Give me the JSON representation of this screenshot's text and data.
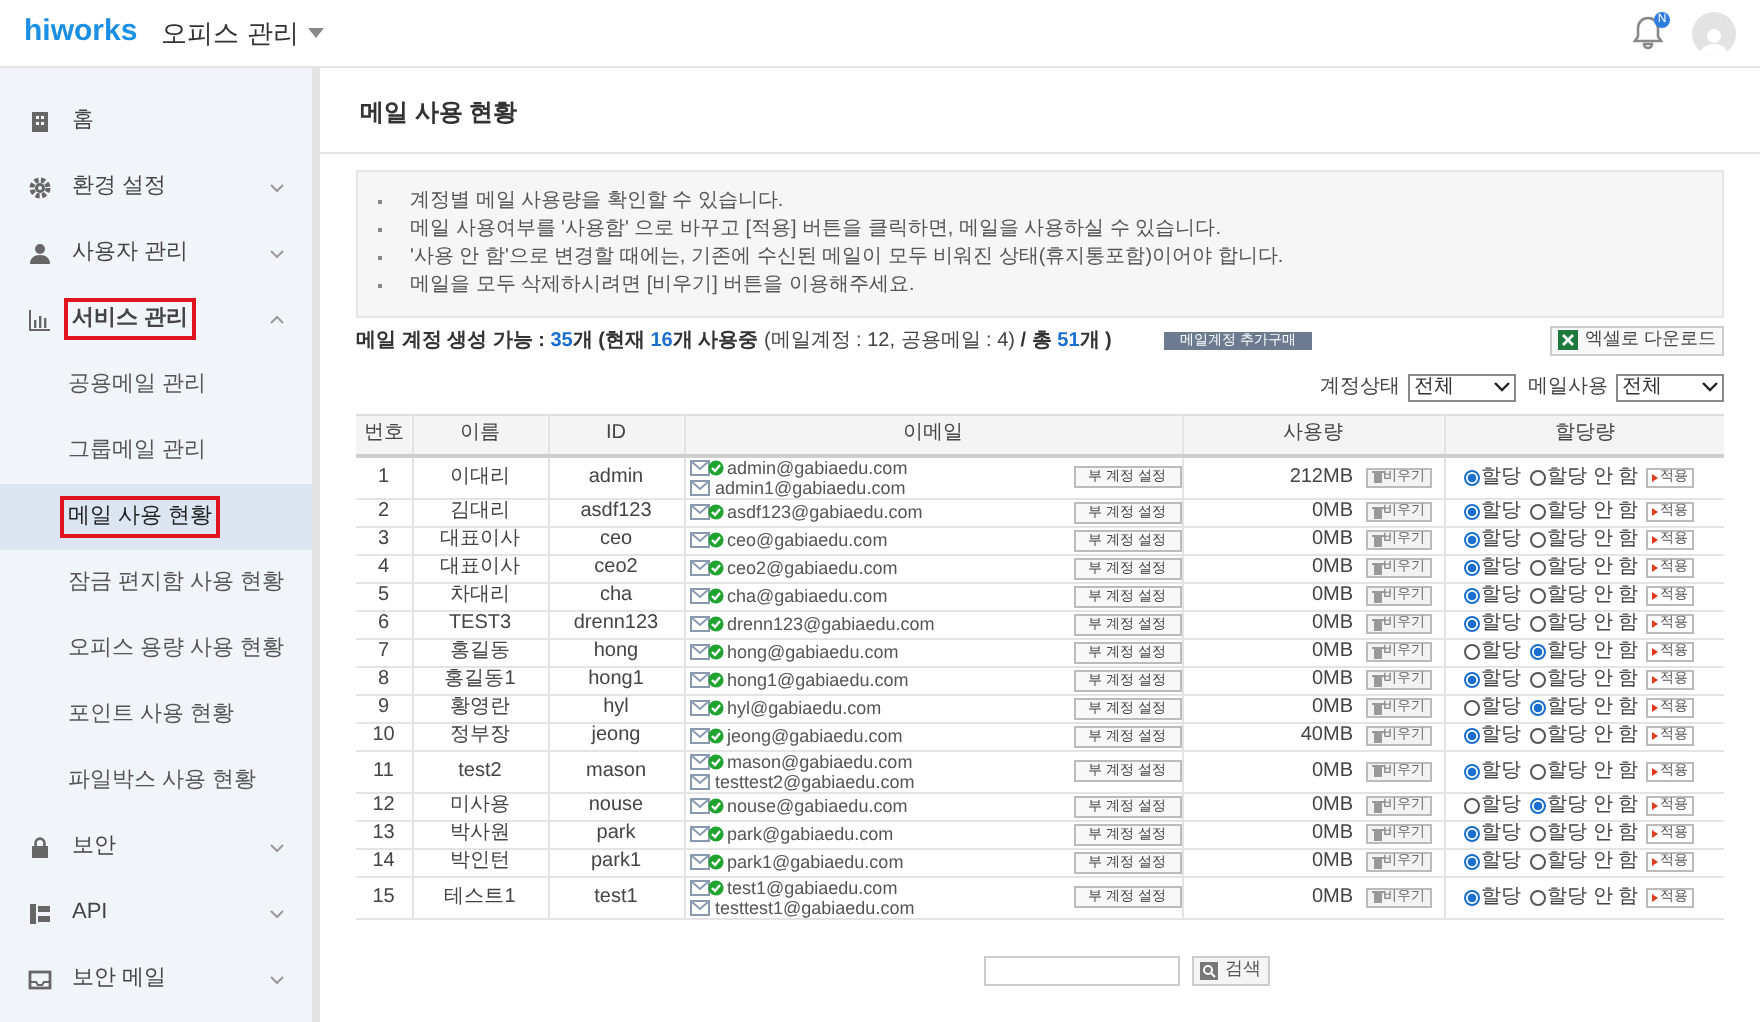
{
  "header": {
    "logo": "hiworks",
    "app_menu": "오피스 관리",
    "notification_badge": "N"
  },
  "sidebar": {
    "items": [
      {
        "label": "홈",
        "kind": "link",
        "highlighted": false
      },
      {
        "label": "환경 설정",
        "kind": "group",
        "expanded": false,
        "highlighted": false
      },
      {
        "label": "사용자 관리",
        "kind": "group",
        "expanded": false,
        "highlighted": false
      },
      {
        "label": "서비스 관리",
        "kind": "group",
        "expanded": true,
        "highlighted": true,
        "children": [
          {
            "label": "공용메일 관리",
            "selected": false,
            "highlighted": false
          },
          {
            "label": "그룹메일 관리",
            "selected": false,
            "highlighted": false
          },
          {
            "label": "메일 사용 현황",
            "selected": true,
            "highlighted": true
          },
          {
            "label": "잠금 편지함 사용 현황",
            "selected": false,
            "highlighted": false
          },
          {
            "label": "오피스 용량 사용 현황",
            "selected": false,
            "highlighted": false
          },
          {
            "label": "포인트 사용 현황",
            "selected": false,
            "highlighted": false
          },
          {
            "label": "파일박스 사용 현황",
            "selected": false,
            "highlighted": false
          }
        ]
      },
      {
        "label": "보안",
        "kind": "group",
        "expanded": false,
        "highlighted": false
      },
      {
        "label": "API",
        "kind": "group",
        "expanded": false,
        "highlighted": false
      },
      {
        "label": "보안 메일",
        "kind": "group",
        "expanded": false,
        "highlighted": false
      }
    ]
  },
  "page_title": "메일 사용 현황",
  "notes": [
    "계정별 메일 사용량을 확인할 수 있습니다.",
    "메일 사용여부를 '사용함' 으로 바꾸고 [적용] 버튼을 클릭하면, 메일을 사용하실 수 있습니다.",
    "'사용 안 함'으로 변경할 때에는, 기존에 수신된 메일이 모두 비워진 상태(휴지통포함)이어야 합니다.",
    "메일을 모두 삭제하시려면 [비우기] 버튼을 이용해주세요."
  ],
  "summary": [
    {
      "text": "메일 계정 생성 가능 : ",
      "kind": "bold"
    },
    {
      "text": "35",
      "kind": "number"
    },
    {
      "text": "개 (현재 ",
      "kind": "bold"
    },
    {
      "text": "16",
      "kind": "number"
    },
    {
      "text": "개 사용중 ",
      "kind": "bold"
    },
    {
      "text": "(메일계정 : 12, 공용메일 : 4)",
      "kind": "plain"
    },
    {
      "text": " / 총 ",
      "kind": "bold"
    },
    {
      "text": "51",
      "kind": "number"
    },
    {
      "text": "개 )",
      "kind": "bold"
    }
  ],
  "buy_button": "메일계정 추가구매",
  "excel_button": "엑셀로 다운로드",
  "filters": [
    {
      "label": "계정상태",
      "value": "전체"
    },
    {
      "label": "메일사용",
      "value": "전체"
    }
  ],
  "table": {
    "columns": [
      "번호",
      "이름",
      "ID",
      "이메일",
      "사용량",
      "할당량"
    ],
    "rows": [
      {
        "no": "1",
        "name": "이대리",
        "id": "admin",
        "emails": [
          {
            "address": "admin@gabiaedu.com",
            "verified": true
          },
          {
            "address": "admin1@gabiaedu.com",
            "verified": false
          }
        ],
        "sub_account_button": "부 계정 설정",
        "usage": "212MB",
        "empty_button": "비우기",
        "radio_on": "할당",
        "radio_off": "할당 안 함",
        "allocated": true,
        "apply_button": "적용"
      },
      {
        "no": "2",
        "name": "김대리",
        "id": "asdf123",
        "emails": [
          {
            "address": "asdf123@gabiaedu.com",
            "verified": true
          }
        ],
        "sub_account_button": "부 계정 설정",
        "usage": "0MB",
        "empty_button": "비우기",
        "radio_on": "할당",
        "radio_off": "할당 안 함",
        "allocated": true,
        "apply_button": "적용"
      },
      {
        "no": "3",
        "name": "대표이사",
        "id": "ceo",
        "emails": [
          {
            "address": "ceo@gabiaedu.com",
            "verified": true
          }
        ],
        "sub_account_button": "부 계정 설정",
        "usage": "0MB",
        "empty_button": "비우기",
        "radio_on": "할당",
        "radio_off": "할당 안 함",
        "allocated": true,
        "apply_button": "적용"
      },
      {
        "no": "4",
        "name": "대표이사",
        "id": "ceo2",
        "emails": [
          {
            "address": "ceo2@gabiaedu.com",
            "verified": true
          }
        ],
        "sub_account_button": "부 계정 설정",
        "usage": "0MB",
        "empty_button": "비우기",
        "radio_on": "할당",
        "radio_off": "할당 안 함",
        "allocated": true,
        "apply_button": "적용"
      },
      {
        "no": "5",
        "name": "차대리",
        "id": "cha",
        "emails": [
          {
            "address": "cha@gabiaedu.com",
            "verified": true
          }
        ],
        "sub_account_button": "부 계정 설정",
        "usage": "0MB",
        "empty_button": "비우기",
        "radio_on": "할당",
        "radio_off": "할당 안 함",
        "allocated": true,
        "apply_button": "적용"
      },
      {
        "no": "6",
        "name": "TEST3",
        "id": "drenn123",
        "emails": [
          {
            "address": "drenn123@gabiaedu.com",
            "verified": true
          }
        ],
        "sub_account_button": "부 계정 설정",
        "usage": "0MB",
        "empty_button": "비우기",
        "radio_on": "할당",
        "radio_off": "할당 안 함",
        "allocated": true,
        "apply_button": "적용"
      },
      {
        "no": "7",
        "name": "홍길동",
        "id": "hong",
        "emails": [
          {
            "address": "hong@gabiaedu.com",
            "verified": true
          }
        ],
        "sub_account_button": "부 계정 설정",
        "usage": "0MB",
        "empty_button": "비우기",
        "radio_on": "할당",
        "radio_off": "할당 안 함",
        "allocated": false,
        "apply_button": "적용"
      },
      {
        "no": "8",
        "name": "홍길동1",
        "id": "hong1",
        "emails": [
          {
            "address": "hong1@gabiaedu.com",
            "verified": true
          }
        ],
        "sub_account_button": "부 계정 설정",
        "usage": "0MB",
        "empty_button": "비우기",
        "radio_on": "할당",
        "radio_off": "할당 안 함",
        "allocated": true,
        "apply_button": "적용"
      },
      {
        "no": "9",
        "name": "황영란",
        "id": "hyl",
        "emails": [
          {
            "address": "hyl@gabiaedu.com",
            "verified": true
          }
        ],
        "sub_account_button": "부 계정 설정",
        "usage": "0MB",
        "empty_button": "비우기",
        "radio_on": "할당",
        "radio_off": "할당 안 함",
        "allocated": false,
        "apply_button": "적용"
      },
      {
        "no": "10",
        "name": "정부장",
        "id": "jeong",
        "emails": [
          {
            "address": "jeong@gabiaedu.com",
            "verified": true
          }
        ],
        "sub_account_button": "부 계정 설정",
        "usage": "40MB",
        "empty_button": "비우기",
        "radio_on": "할당",
        "radio_off": "할당 안 함",
        "allocated": true,
        "apply_button": "적용"
      },
      {
        "no": "11",
        "name": "test2",
        "id": "mason",
        "emails": [
          {
            "address": "mason@gabiaedu.com",
            "verified": true
          },
          {
            "address": "testtest2@gabiaedu.com",
            "verified": false
          }
        ],
        "sub_account_button": "부 계정 설정",
        "usage": "0MB",
        "empty_button": "비우기",
        "radio_on": "할당",
        "radio_off": "할당 안 함",
        "allocated": true,
        "apply_button": "적용"
      },
      {
        "no": "12",
        "name": "미사용",
        "id": "nouse",
        "emails": [
          {
            "address": "nouse@gabiaedu.com",
            "verified": true
          }
        ],
        "sub_account_button": "부 계정 설정",
        "usage": "0MB",
        "empty_button": "비우기",
        "radio_on": "할당",
        "radio_off": "할당 안 함",
        "allocated": false,
        "apply_button": "적용"
      },
      {
        "no": "13",
        "name": "박사원",
        "id": "park",
        "emails": [
          {
            "address": "park@gabiaedu.com",
            "verified": true
          }
        ],
        "sub_account_button": "부 계정 설정",
        "usage": "0MB",
        "empty_button": "비우기",
        "radio_on": "할당",
        "radio_off": "할당 안 함",
        "allocated": true,
        "apply_button": "적용"
      },
      {
        "no": "14",
        "name": "박인턴",
        "id": "park1",
        "emails": [
          {
            "address": "park1@gabiaedu.com",
            "verified": true
          }
        ],
        "sub_account_button": "부 계정 설정",
        "usage": "0MB",
        "empty_button": "비우기",
        "radio_on": "할당",
        "radio_off": "할당 안 함",
        "allocated": true,
        "apply_button": "적용"
      },
      {
        "no": "15",
        "name": "테스트1",
        "id": "test1",
        "emails": [
          {
            "address": "test1@gabiaedu.com",
            "verified": true
          },
          {
            "address": "testtest1@gabiaedu.com",
            "verified": false
          }
        ],
        "sub_account_button": "부 계정 설정",
        "usage": "0MB",
        "empty_button": "비우기",
        "radio_on": "할당",
        "radio_off": "할당 안 함",
        "allocated": true,
        "apply_button": "적용"
      }
    ]
  },
  "search_button": "검색"
}
